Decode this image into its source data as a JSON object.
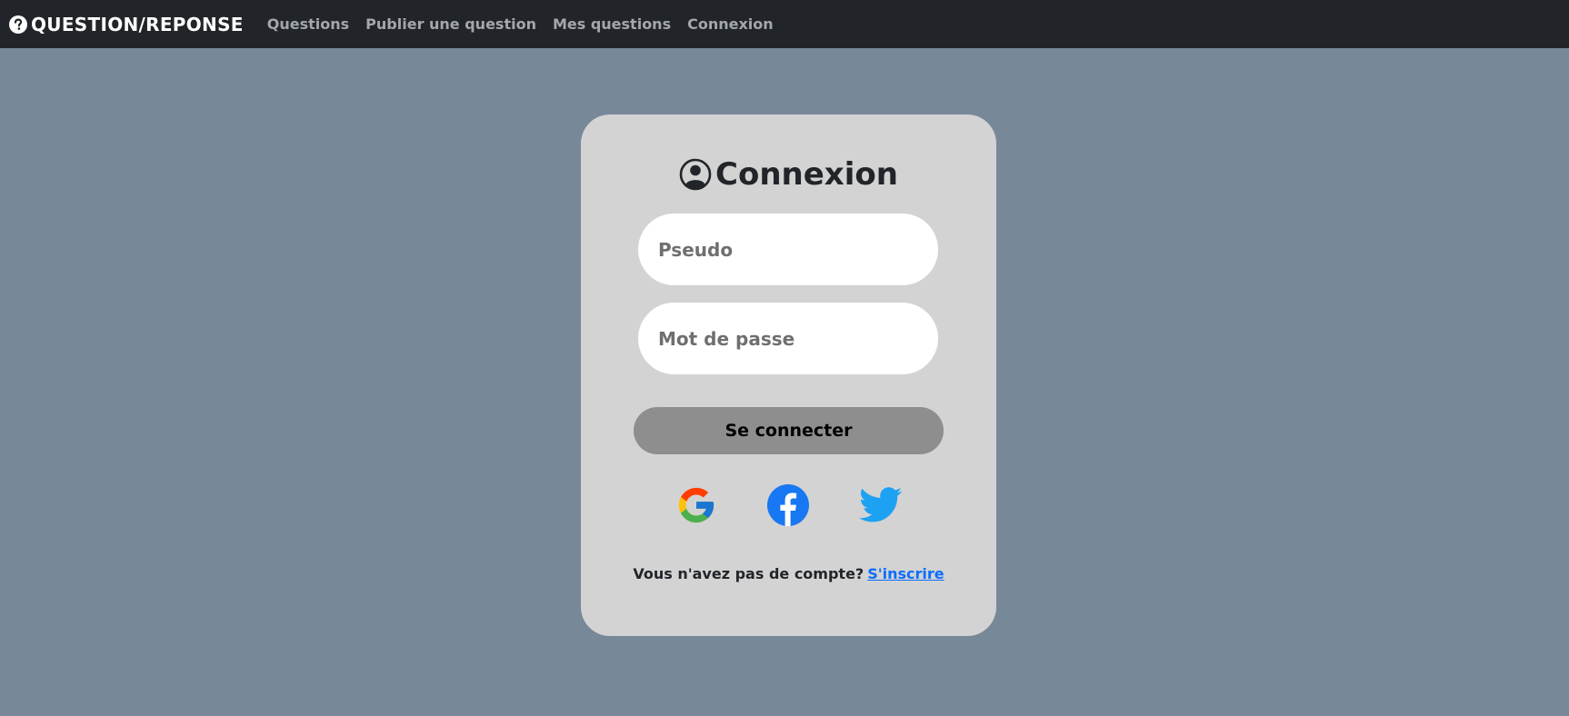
{
  "navbar": {
    "brand_label": "QUESTION/REPONSE",
    "brand_icon": "question-circle-icon",
    "links": [
      "Questions",
      "Publier une question",
      "Mes questions",
      "Connexion"
    ]
  },
  "login_card": {
    "title": "Connexion",
    "title_icon": "user-circle-icon",
    "pseudo_placeholder": "Pseudo",
    "password_placeholder": "Mot de passe",
    "submit_label": "Se connecter",
    "social_providers": [
      "google",
      "facebook",
      "twitter"
    ],
    "signup_prompt": "Vous n'avez pas de compte?",
    "signup_link": "S'inscrire"
  },
  "colors": {
    "background": "#778899",
    "navbar": "#212529",
    "card": "#d3d3d3",
    "button": "#8e8e8e",
    "link": "#0d6efd"
  }
}
